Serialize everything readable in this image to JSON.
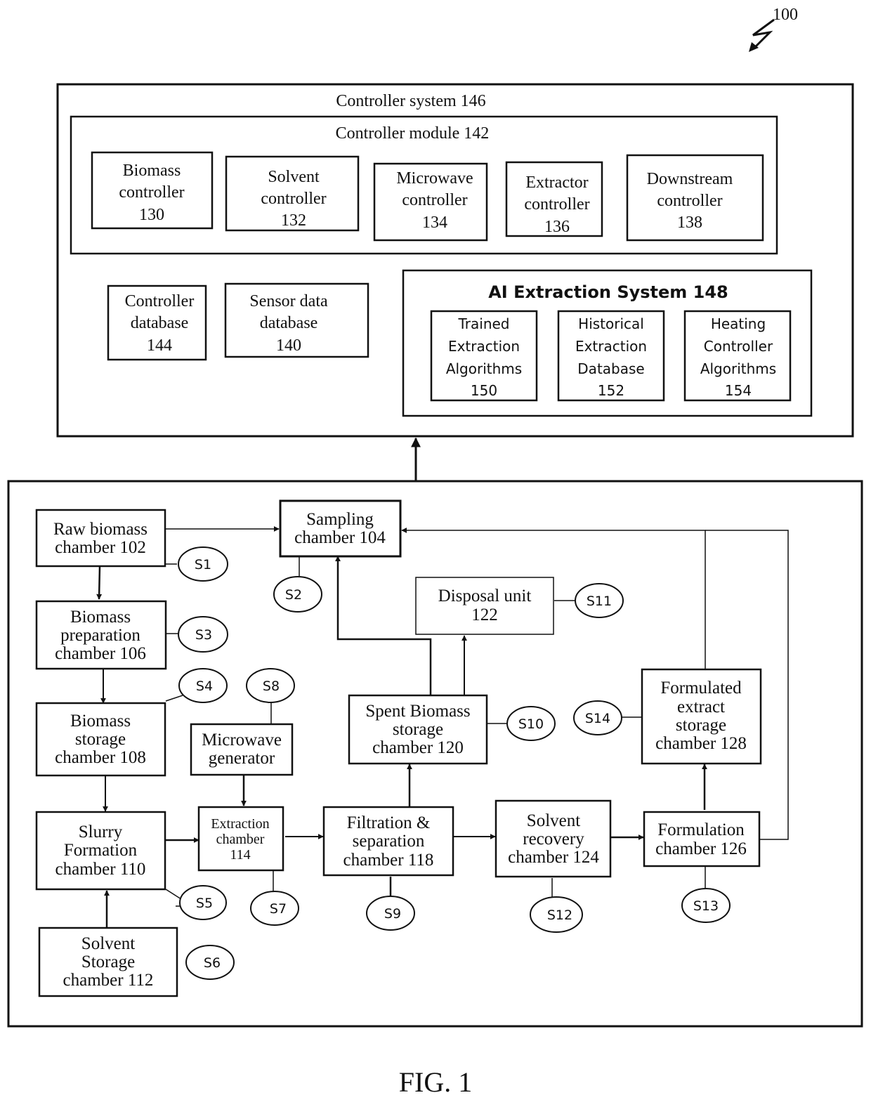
{
  "figure": {
    "ref_number": "100",
    "caption": "FIG. 1"
  },
  "controller_system": {
    "title": "Controller system 146",
    "module": {
      "title": "Controller module 142",
      "controllers": [
        {
          "lines": [
            "Biomass",
            "controller",
            "130"
          ]
        },
        {
          "lines": [
            "Solvent",
            "controller",
            "132"
          ]
        },
        {
          "lines": [
            "Microwave",
            "controller",
            "134"
          ]
        },
        {
          "lines": [
            "Extractor",
            "controller",
            "136"
          ]
        },
        {
          "lines": [
            "Downstream",
            "controller",
            "138"
          ]
        }
      ]
    },
    "databases": [
      {
        "lines": [
          "Controller",
          "database",
          "144"
        ]
      },
      {
        "lines": [
          "Sensor data",
          "database",
          "140"
        ]
      }
    ],
    "ai_system": {
      "title": "AI Extraction System 148",
      "items": [
        {
          "lines": [
            "Trained",
            "Extraction",
            "Algorithms",
            "150"
          ]
        },
        {
          "lines": [
            "Historical",
            "Extraction",
            "Database",
            "152"
          ]
        },
        {
          "lines": [
            "Heating",
            "Controller",
            "Algorithms",
            "154"
          ]
        }
      ]
    }
  },
  "process": {
    "units": {
      "raw_biomass": [
        "Raw biomass",
        "chamber 102"
      ],
      "sampling": [
        "Sampling",
        "chamber 104"
      ],
      "biomass_prep": [
        "Biomass",
        "preparation",
        "chamber 106"
      ],
      "biomass_storage": [
        "Biomass",
        "storage",
        "chamber 108"
      ],
      "slurry": [
        "Slurry",
        "Formation",
        "chamber 110"
      ],
      "solvent_storage": [
        "Solvent",
        "Storage",
        "chamber 112"
      ],
      "microwave_gen": [
        "Microwave",
        "generator"
      ],
      "extraction": [
        "Extraction",
        "chamber",
        "114"
      ],
      "filtration": [
        "Filtration &",
        "separation",
        "chamber 118"
      ],
      "spent_biomass": [
        "Spent Biomass",
        "storage",
        "chamber 120"
      ],
      "disposal": [
        "Disposal unit",
        "122"
      ],
      "solvent_recovery": [
        "Solvent",
        "recovery",
        "chamber 124"
      ],
      "formulation": [
        "Formulation",
        "chamber 126"
      ],
      "formulated_storage": [
        "Formulated",
        "extract",
        "storage",
        "chamber 128"
      ]
    },
    "sensors": {
      "S1": "S1",
      "S2": "S2",
      "S3": "S3",
      "S4": "S4",
      "S5": "S5",
      "S6": "S6",
      "S7": "S7",
      "S8": "S8",
      "S9": "S9",
      "S10": "S10",
      "S11": "S11",
      "S12": "S12",
      "S13": "S13",
      "S14": "S14"
    }
  }
}
